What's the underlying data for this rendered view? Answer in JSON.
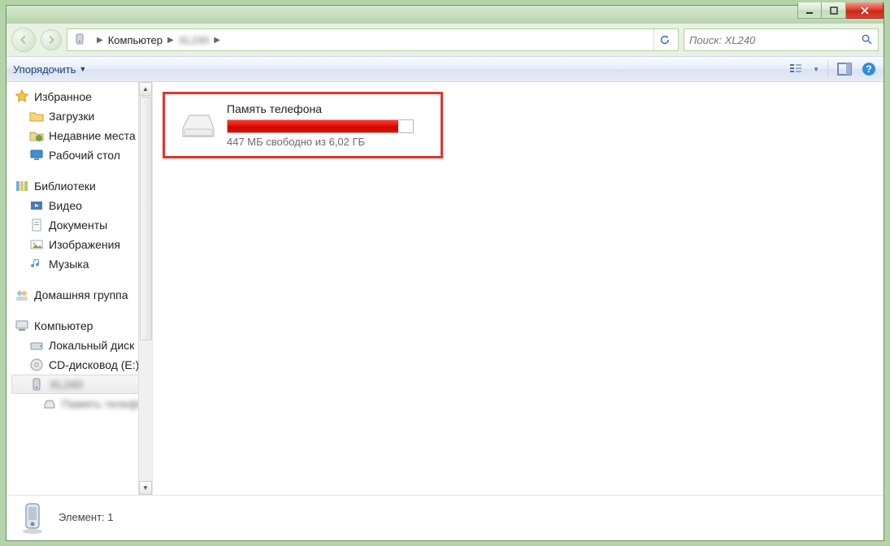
{
  "breadcrumb": {
    "root": "Компьютер"
  },
  "search": {
    "placeholder": "Поиск: XL240"
  },
  "toolbar": {
    "organize": "Упорядочить"
  },
  "sidebar": {
    "favorites": {
      "label": "Избранное",
      "items": [
        "Загрузки",
        "Недавние места",
        "Рабочий стол"
      ]
    },
    "libraries": {
      "label": "Библиотеки",
      "items": [
        "Видео",
        "Документы",
        "Изображения",
        "Музыка"
      ]
    },
    "homegroup": {
      "label": "Домашняя группа"
    },
    "computer": {
      "label": "Компьютер",
      "items": [
        "Локальный диск",
        "CD-дисковод (E:)"
      ]
    }
  },
  "drive": {
    "title": "Память телефона",
    "free_text": "447 МБ свободно из 6,02 ГБ",
    "used_percent": 92
  },
  "status": {
    "label": "Элемент: 1"
  }
}
